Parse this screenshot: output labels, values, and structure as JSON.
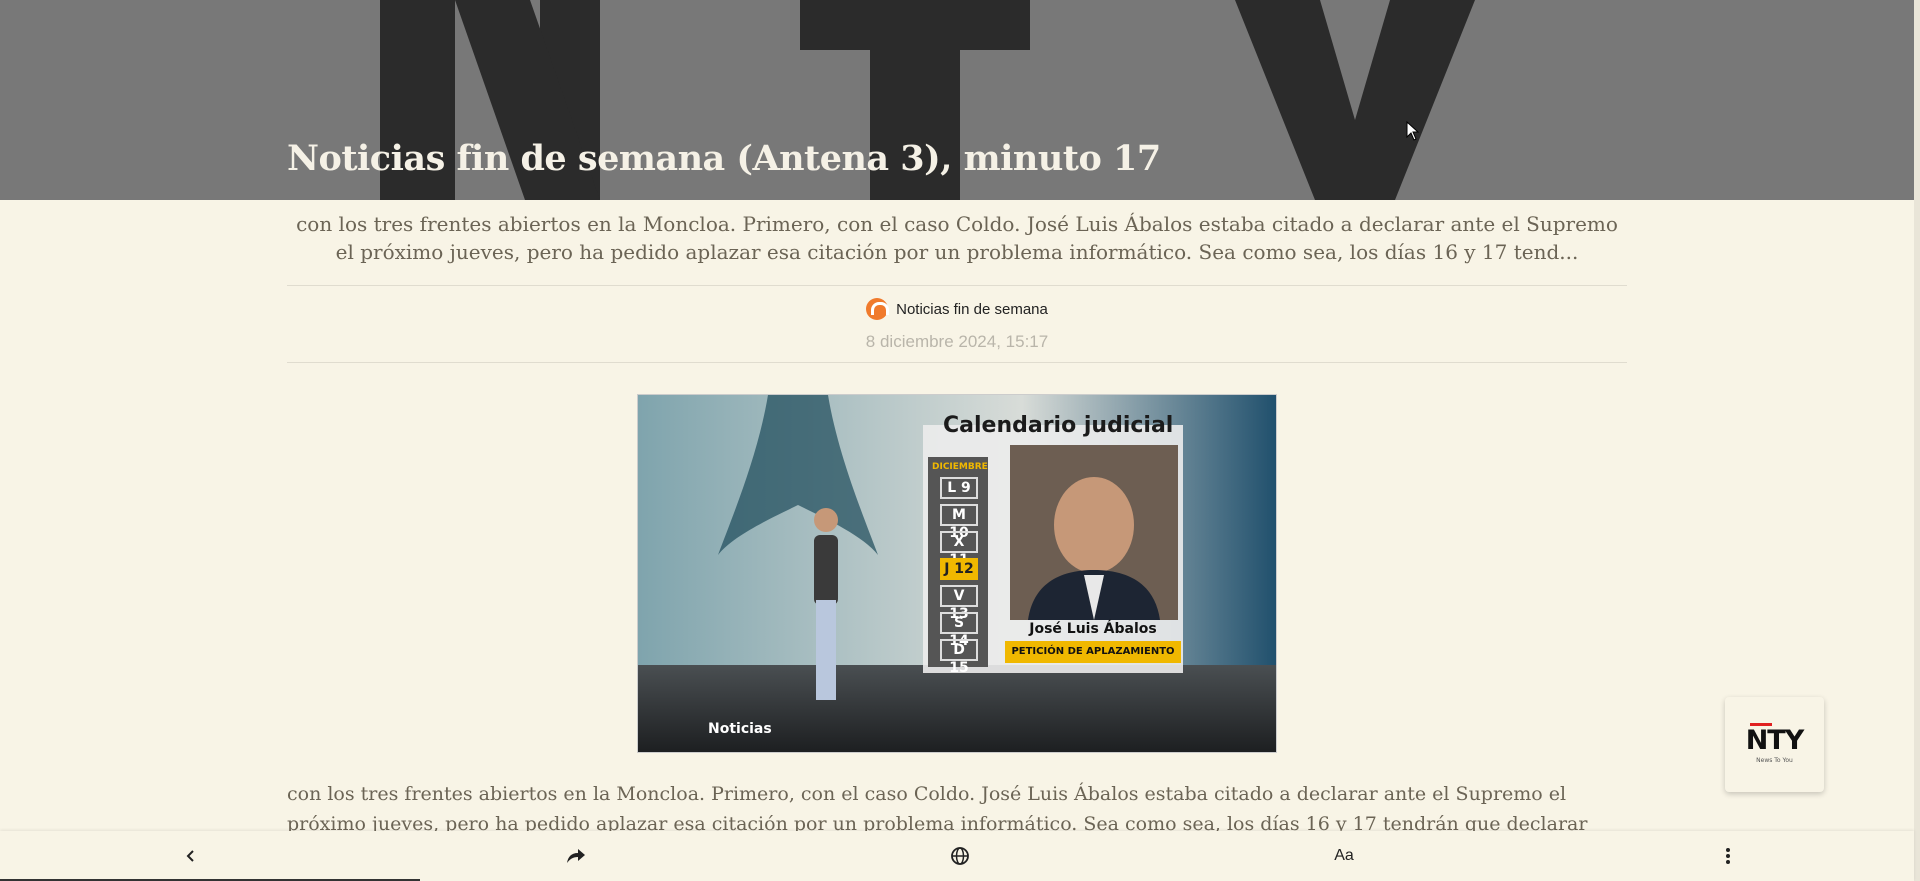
{
  "hero": {
    "bg_letters": "NTY",
    "title": "Noticias fin de semana (Antena 3), minuto 17"
  },
  "article": {
    "summary": "con los tres frentes abiertos en la Moncloa. Primero, con el caso Coldo. José Luis Ábalos estaba citado a declarar ante el Supremo el próximo jueves, pero ha pedido aplazar esa citación por un problema informático. Sea como sea, los días 16 y 17 tend...",
    "source_name": "Noticias fin de semana",
    "date": "8 diciembre 2024, 15:17",
    "body": "con los tres frentes abiertos en la Moncloa. Primero, con el caso Coldo. José Luis Ábalos estaba citado a declarar ante el Supremo el próximo jueves, pero ha pedido aplazar esa citación por un problema informático. Sea como sea, los días 16 y 17 tendrán que declarar Víctor de Aldama y Coldo García. Esa misma"
  },
  "image": {
    "title": "Calendario judicial",
    "month": "DICIEMBRE",
    "days": [
      "L 9",
      "M 10",
      "X 11",
      "J 12",
      "V 13",
      "S 14",
      "D 15"
    ],
    "active_day": "J 12",
    "person": "José Luis Ábalos",
    "caption": "PETICIÓN DE APLAZAMIENTO",
    "brand": "Noticias"
  },
  "badge": {
    "logo": "NTY",
    "tagline": "News To You"
  },
  "bottom_bar": {
    "text_size_label": "Aa"
  },
  "colors": {
    "background": "#f8f4e6",
    "hero": "#787878",
    "accent": "#f0b800",
    "source_logo": "#f07a2c"
  }
}
